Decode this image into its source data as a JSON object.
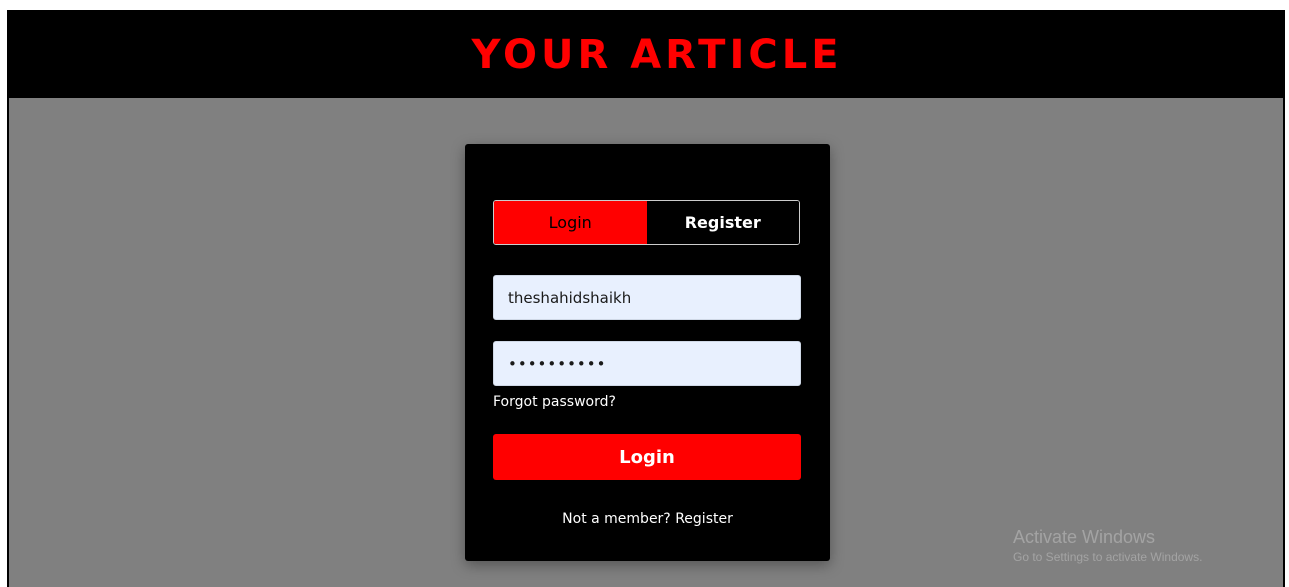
{
  "header": {
    "title": "YOUR ARTICLE"
  },
  "auth": {
    "tabs": [
      {
        "label": "Login",
        "active": true
      },
      {
        "label": "Register",
        "active": false
      }
    ],
    "username": {
      "value": "theshahidshaikh"
    },
    "password": {
      "masked_value": "••••••••••"
    },
    "forgot_label": "Forgot password?",
    "submit_label": "Login",
    "not_member_text": "Not a member?",
    "register_link": "Register"
  },
  "watermark": {
    "title": "Activate Windows",
    "subtitle": "Go to Settings to activate Windows."
  },
  "colors": {
    "accent": "#ff0000",
    "header_bg": "#000000",
    "page_bg": "#808080",
    "input_bg": "#e8f0fe"
  }
}
